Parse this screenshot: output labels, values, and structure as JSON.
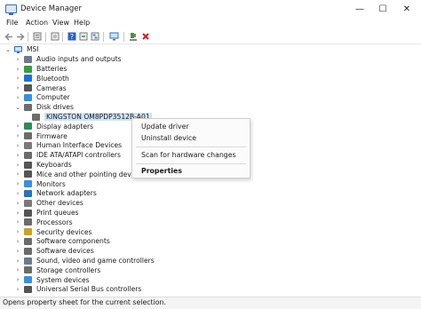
{
  "window": {
    "title": "Device Manager",
    "minimize_glyph": "—",
    "maximize_glyph": "☐",
    "close_glyph": "✕"
  },
  "menubar": {
    "items": [
      "File",
      "Action",
      "View",
      "Help"
    ]
  },
  "toolbar": {
    "icons": [
      "back-arrow-icon",
      "forward-arrow-icon",
      "properties-icon",
      "update-driver-icon",
      "help-icon",
      "toggle-view-icon",
      "tree-view-icon",
      "scan-hardware-icon",
      "enable-device-icon",
      "uninstall-device-icon"
    ]
  },
  "tree": {
    "root": "MSI",
    "categories": [
      {
        "label": "Audio inputs and outputs",
        "icon": "speaker-icon",
        "color": "#6b7b8c"
      },
      {
        "label": "Batteries",
        "icon": "battery-icon",
        "color": "#3d9a3d"
      },
      {
        "label": "Bluetooth",
        "icon": "bluetooth-icon",
        "color": "#1f6fd1"
      },
      {
        "label": "Cameras",
        "icon": "camera-icon",
        "color": "#555555"
      },
      {
        "label": "Computer",
        "icon": "monitor-icon",
        "color": "#3a8fd6"
      },
      {
        "label": "Disk drives",
        "icon": "disk-drive-icon",
        "color": "#6d6d6d",
        "expanded": true
      },
      {
        "label": "KINGSTON OM8PDP3512B-A01",
        "icon": "disk-drive-icon",
        "color": "#6d6d6d",
        "child": true,
        "selected": true
      },
      {
        "label": "Display adapters",
        "icon": "display-adapter-icon",
        "color": "#2e8b57"
      },
      {
        "label": "Firmware",
        "icon": "firmware-icon",
        "color": "#6b6b6b"
      },
      {
        "label": "Human Interface Devices",
        "icon": "hid-icon",
        "color": "#7a7a7a"
      },
      {
        "label": "IDE ATA/ATAPI controllers",
        "icon": "ide-controller-icon",
        "color": "#6b6b6b"
      },
      {
        "label": "Keyboards",
        "icon": "keyboard-icon",
        "color": "#555555"
      },
      {
        "label": "Mice and other pointing devices",
        "icon": "mouse-icon",
        "color": "#555555"
      },
      {
        "label": "Monitors",
        "icon": "monitor-icon",
        "color": "#3a8fd6"
      },
      {
        "label": "Network adapters",
        "icon": "network-adapter-icon",
        "color": "#2e6fb6"
      },
      {
        "label": "Other devices",
        "icon": "other-devices-icon",
        "color": "#7a7a7a"
      },
      {
        "label": "Print queues",
        "icon": "printer-icon",
        "color": "#555555"
      },
      {
        "label": "Processors",
        "icon": "processor-icon",
        "color": "#6b6b6b"
      },
      {
        "label": "Security devices",
        "icon": "security-device-icon",
        "color": "#c9a227"
      },
      {
        "label": "Software components",
        "icon": "software-component-icon",
        "color": "#6b6b6b"
      },
      {
        "label": "Software devices",
        "icon": "software-device-icon",
        "color": "#6b6b6b"
      },
      {
        "label": "Sound, video and game controllers",
        "icon": "speaker-icon",
        "color": "#6b7b8c"
      },
      {
        "label": "Storage controllers",
        "icon": "storage-controller-icon",
        "color": "#6b6b6b"
      },
      {
        "label": "System devices",
        "icon": "system-device-icon",
        "color": "#3a8fd6"
      },
      {
        "label": "Universal Serial Bus controllers",
        "icon": "usb-icon",
        "color": "#555555"
      }
    ]
  },
  "context_menu": {
    "update_driver": "Update driver",
    "uninstall_device": "Uninstall device",
    "scan_hardware": "Scan for hardware changes",
    "properties": "Properties"
  },
  "statusbar": {
    "text": "Opens property sheet for the current selection."
  }
}
